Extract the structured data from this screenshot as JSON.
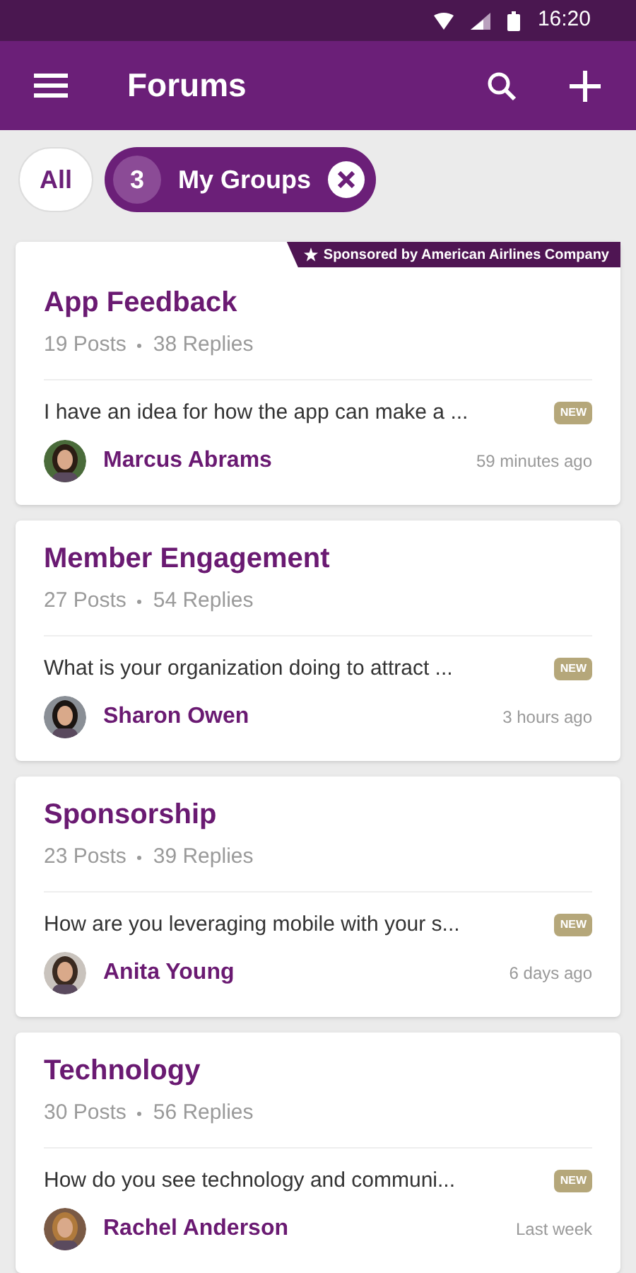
{
  "status_bar": {
    "time": "16:20"
  },
  "app_bar": {
    "title": "Forums"
  },
  "filters": [
    {
      "label": "All",
      "selected": false
    },
    {
      "label": "My Groups",
      "count": "3",
      "selected": true
    }
  ],
  "forums": [
    {
      "sponsor": "Sponsored by American Airlines Company",
      "title": "App Feedback",
      "posts": "19 Posts",
      "replies": "38 Replies",
      "latest": "I have an idea for how the app can make a ...",
      "badge": "NEW",
      "author": "Marcus Abrams",
      "time": "59 minutes ago"
    },
    {
      "title": "Member Engagement",
      "posts": "27 Posts",
      "replies": "54 Replies",
      "latest": "What is your organization doing to attract ...",
      "badge": "NEW",
      "author": "Sharon Owen",
      "time": "3 hours ago"
    },
    {
      "title": "Sponsorship",
      "posts": "23 Posts",
      "replies": "39 Replies",
      "latest": "How are you leveraging mobile with your s...",
      "badge": "NEW",
      "author": "Anita Young",
      "time": "6 days ago"
    },
    {
      "title": "Technology",
      "posts": "30 Posts",
      "replies": "56 Replies",
      "latest": "How do you see technology and communi...",
      "badge": "NEW",
      "author": "Rachel Anderson",
      "time": "Last week"
    }
  ]
}
